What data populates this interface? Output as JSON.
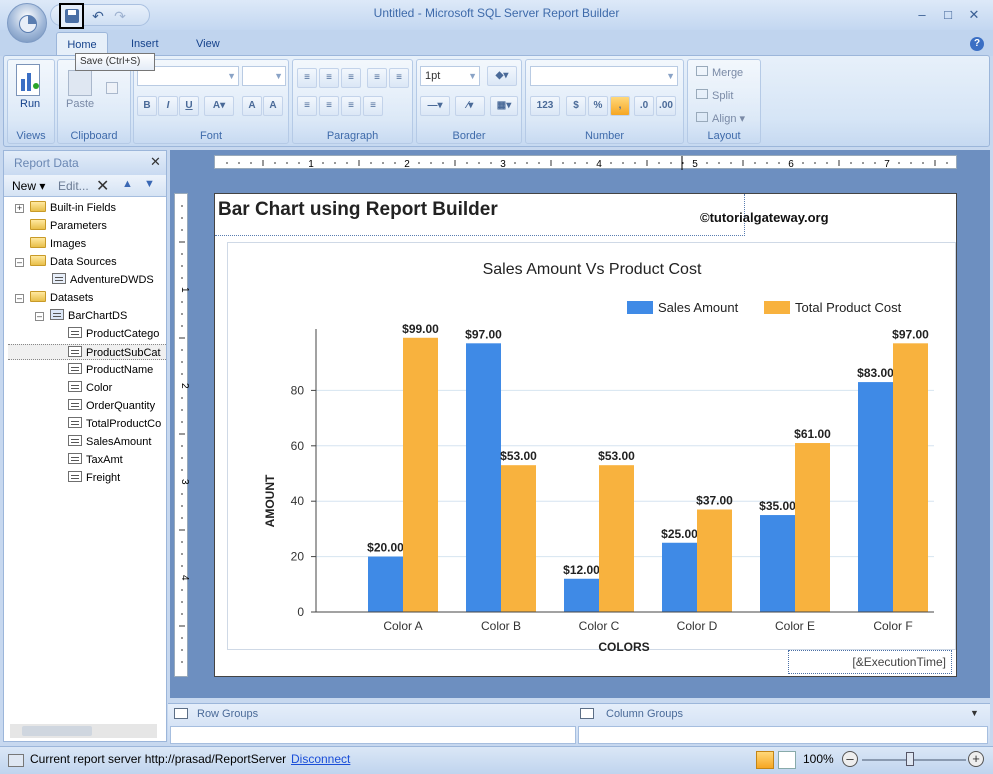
{
  "window": {
    "title": "Untitled - Microsoft SQL Server Report Builder"
  },
  "tooltip": "Save (Ctrl+S)",
  "tabs": [
    "Home",
    "Insert",
    "View"
  ],
  "ribbon": {
    "run_label": "Run",
    "paste_label": "Paste",
    "font_size": "1pt",
    "groups": [
      "Views",
      "Clipboard",
      "Font",
      "Paragraph",
      "Border",
      "Number",
      "Layout"
    ],
    "layout_buttons": [
      "Merge",
      "Split",
      "Align"
    ]
  },
  "report_data": {
    "title": "Report Data",
    "toolbar": {
      "new_label": "New",
      "edit_label": "Edit..."
    },
    "tree": [
      "Built-in Fields",
      "Parameters",
      "Images",
      "Data Sources",
      "AdventureDWDS",
      "Datasets",
      "BarChartDS",
      "ProductCatego",
      "ProductSubCat",
      "ProductName",
      "Color",
      "OrderQuantity",
      "TotalProductCo",
      "SalesAmount",
      "TaxAmt",
      "Freight"
    ]
  },
  "ruler": {
    "h_labels": [
      "1",
      "2",
      "3",
      "4",
      "5",
      "6",
      "7"
    ],
    "v_labels": [
      "1",
      "2",
      "3",
      "4"
    ]
  },
  "report": {
    "title": "Bar Chart using Report Builder",
    "watermark": "©tutorialgateway.org",
    "exec_time": "[&ExecutionTime]"
  },
  "chart_data": {
    "type": "bar",
    "title": "Sales Amount Vs Product Cost",
    "xlabel": "COLORS",
    "ylabel": "AMOUNT",
    "categories": [
      "Color A",
      "Color B",
      "Color C",
      "Color D",
      "Color E",
      "Color F"
    ],
    "series": [
      {
        "name": "Sales Amount",
        "color": "#3f8ae6",
        "values": [
          20,
          97,
          12,
          25,
          35,
          83
        ],
        "labels": [
          "$20.00",
          "$97.00",
          "$12.00",
          "$25.00",
          "$35.00",
          "$83.00"
        ]
      },
      {
        "name": "Total Product Cost",
        "color": "#f8b23e",
        "values": [
          99,
          53,
          53,
          37,
          61,
          97
        ],
        "labels": [
          "$99.00",
          "$53.00",
          "$53.00",
          "$37.00",
          "$61.00",
          "$97.00"
        ]
      }
    ],
    "yticks": [
      0,
      20,
      40,
      60,
      80
    ],
    "ylim": [
      0,
      100
    ],
    "legend_position": "top-right",
    "grid": true
  },
  "groups": {
    "row_label": "Row Groups",
    "column_label": "Column Groups"
  },
  "status": {
    "server_text": "Current report server http://prasad/ReportServer",
    "disconnect_label": "Disconnect",
    "zoom": "100%"
  }
}
